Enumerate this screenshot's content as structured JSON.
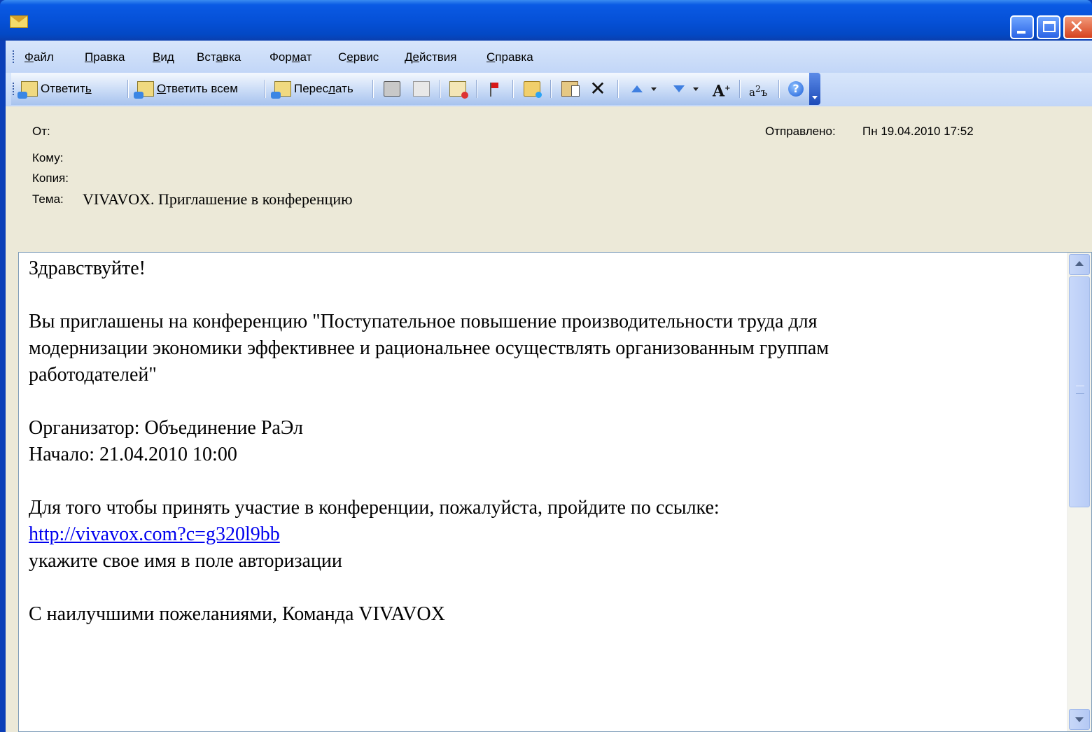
{
  "window": {
    "icon": "envelope-icon"
  },
  "menu": [
    {
      "label": "Файл",
      "u": "Ф",
      "rest": "айл"
    },
    {
      "label": "Правка",
      "u": "П",
      "rest": "равка"
    },
    {
      "label": "Вид",
      "pre": "",
      "u": "В",
      "rest": "ид"
    },
    {
      "label": "Вставка",
      "pre": "Вст",
      "u": "а",
      "rest": "вка"
    },
    {
      "label": "Формат",
      "pre": "Фор",
      "u": "м",
      "rest": "ат"
    },
    {
      "label": "Сервис",
      "pre": "С",
      "u": "е",
      "rest": "рвис"
    },
    {
      "label": "Действия",
      "pre": "Д",
      "u": "е",
      "rest": "йствия"
    },
    {
      "label": "Справка",
      "pre": "",
      "u": "С",
      "rest": "правка"
    }
  ],
  "toolbar": {
    "reply": {
      "pre": "Ответит",
      "u": "ь",
      "rest": ""
    },
    "reply_all": {
      "pre": "",
      "u": "О",
      "rest": "тветить всем"
    },
    "forward": {
      "pre": "Перес",
      "u": "л",
      "rest": "ать"
    },
    "icons": [
      "reply-icon",
      "reply-all-icon",
      "forward-icon",
      "print-icon",
      "copy-icon",
      "move-icon",
      "flag-icon",
      "folder-icon",
      "paste-icon",
      "delete-icon",
      "previous-item-icon",
      "next-item-icon",
      "font-size-icon",
      "translate-icon",
      "help-icon"
    ]
  },
  "header": {
    "from_label": "От:",
    "to_label": "Кому:",
    "cc_label": "Копия:",
    "subject_label": "Тема:",
    "subject": "VIVAVOX. Приглашение в конференцию",
    "sent_label": "Отправлено:",
    "sent_value": "Пн 19.04.2010 17:52"
  },
  "message": {
    "greeting": "Здравствуйте!",
    "invite_line1": "Вы приглашены на конференцию \"Поступательное повышение производительности труда для",
    "invite_line2": "модернизации экономики эффективнее и рациональнее осуществлять организованным группам",
    "invite_line3": "работодателей\"",
    "organizer": "Организатор: Объединение РаЭл",
    "start": "Начало: 21.04.2010 10:00",
    "instruction": "Для того чтобы принять участие в конференции, пожалуйста, пройдите по ссылке:",
    "link": "http://vivavox.com?c=g320l9bb",
    "name_hint": "укажите свое имя в поле авторизации",
    "signoff": "С наилучшими пожеланиями, Команда VIVAVOX"
  }
}
